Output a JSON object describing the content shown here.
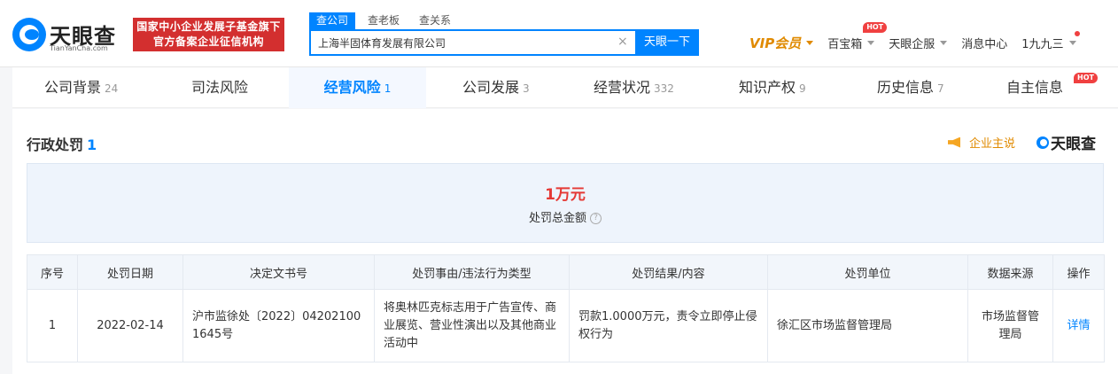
{
  "header": {
    "logo_name": "天眼查",
    "logo_sub": "TianYanCha.com",
    "gov_badge_line1": "国家中小企业发展子基金旗下",
    "gov_badge_line2": "官方备案企业征信机构",
    "search_tabs": [
      "查公司",
      "查老板",
      "查关系"
    ],
    "search_value": "上海半固体育发展有限公司",
    "search_button": "天眼一下",
    "nav": {
      "vip": "VIP会员",
      "treasure": "百宝箱",
      "treasure_badge": "HOT",
      "enterprise": "天眼企服",
      "messages": "消息中心",
      "user": "1九九三"
    }
  },
  "tabs": [
    {
      "label": "公司背景",
      "count": "24"
    },
    {
      "label": "司法风险",
      "count": ""
    },
    {
      "label": "经营风险",
      "count": "1"
    },
    {
      "label": "公司发展",
      "count": "3"
    },
    {
      "label": "经营状况",
      "count": "332"
    },
    {
      "label": "知识产权",
      "count": "9"
    },
    {
      "label": "历史信息",
      "count": "7"
    },
    {
      "label": "自主信息",
      "count": "",
      "badge": "HOT"
    }
  ],
  "section": {
    "title": "行政处罚",
    "count": "1",
    "ent_say": "企业主说",
    "brand": "天眼查"
  },
  "summary": {
    "amount": "1万元",
    "label": "处罚总金额",
    "help": "?"
  },
  "table": {
    "headers": [
      "序号",
      "处罚日期",
      "决定文书号",
      "处罚事由/违法行为类型",
      "处罚结果/内容",
      "处罚单位",
      "数据来源",
      "操作"
    ],
    "rows": [
      {
        "no": "1",
        "date": "2022-02-14",
        "doc": "沪市监徐处〔2022〕042021001645号",
        "reason": "将奥林匹克标志用于广告宣传、商业展览、营业性演出以及其他商业活动中",
        "result": "罚款1.0000万元，责令立即停止侵权行为",
        "unit": "徐汇区市场监督管理局",
        "source": "市场监督管理局",
        "action": "详情"
      }
    ]
  },
  "colors": {
    "brand_blue": "#0084ff",
    "alert_red": "#e53935",
    "vip_orange": "#e08a00"
  }
}
